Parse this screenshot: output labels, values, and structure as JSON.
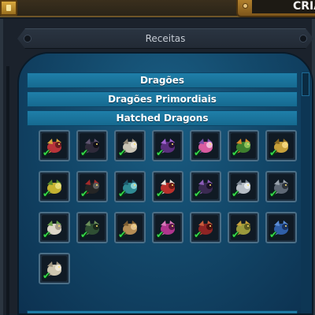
{
  "header": {
    "right_tab_label": "CRIA"
  },
  "panel": {
    "title": "Receitas"
  },
  "categories": [
    {
      "label": "Dragões"
    },
    {
      "label": "Dragões Primordiais"
    },
    {
      "label": "Hatched Dragons"
    }
  ],
  "recipes": [
    {
      "icon": "dragon-red-gold-icon",
      "colors": [
        "#b8343a",
        "#d7a63d",
        "#6a1c20"
      ],
      "crafted": true
    },
    {
      "icon": "dragon-dark-icon",
      "colors": [
        "#2e2a3a",
        "#5e5470",
        "#111018"
      ],
      "crafted": true
    },
    {
      "icon": "dragon-white-bone-icon",
      "colors": [
        "#c9c4b5",
        "#8c8373",
        "#e9e5da"
      ],
      "crafted": true
    },
    {
      "icon": "dragon-purple-shadow-icon",
      "colors": [
        "#5b2f7e",
        "#a061d0",
        "#241233"
      ],
      "crafted": true
    },
    {
      "icon": "dragon-pink-crystal-icon",
      "colors": [
        "#d95ba0",
        "#7a4da8",
        "#f1b6d9"
      ],
      "crafted": true
    },
    {
      "icon": "dragon-green-orange-icon",
      "colors": [
        "#3d7f2e",
        "#d88b2b",
        "#8cc25a"
      ],
      "crafted": true
    },
    {
      "icon": "dragon-gold-icon",
      "colors": [
        "#c8a13b",
        "#8c6a22",
        "#f1d27a"
      ],
      "crafted": true
    },
    {
      "icon": "dragon-yellow-green-icon",
      "colors": [
        "#c5b332",
        "#5b8d2c",
        "#e7de79"
      ],
      "crafted": true
    },
    {
      "icon": "dragon-black-red-icon",
      "colors": [
        "#252525",
        "#a32a2a",
        "#5f5f5f"
      ],
      "crafted": true
    },
    {
      "icon": "dragon-teal-icon",
      "colors": [
        "#2f8b94",
        "#1d5b6e",
        "#8ad3d6"
      ],
      "crafted": true
    },
    {
      "icon": "dragon-red-white-icon",
      "colors": [
        "#b9302b",
        "#e8e2d8",
        "#6b1a16"
      ],
      "crafted": true
    },
    {
      "icon": "dragon-violet-icon",
      "colors": [
        "#3a2a52",
        "#8c5db8",
        "#1a1226"
      ],
      "crafted": true
    },
    {
      "icon": "dragon-silver-icon",
      "colors": [
        "#b7bec6",
        "#7d8793",
        "#e6ebef"
      ],
      "crafted": true
    },
    {
      "icon": "dragon-steel-icon",
      "colors": [
        "#5e6875",
        "#9aa4ae",
        "#2d333b"
      ],
      "crafted": true
    },
    {
      "icon": "dragon-white-green-icon",
      "colors": [
        "#ddd7c9",
        "#6aa04a",
        "#a59c8a"
      ],
      "crafted": true
    },
    {
      "icon": "dragon-forest-icon",
      "colors": [
        "#2f4f34",
        "#6b8f5a",
        "#1a2a1d"
      ],
      "crafted": true
    },
    {
      "icon": "dragon-tan-icon",
      "colors": [
        "#b58d55",
        "#7c5c31",
        "#e2c28e"
      ],
      "crafted": true
    },
    {
      "icon": "dragon-magenta-icon",
      "colors": [
        "#b0358d",
        "#d779b9",
        "#5a1848"
      ],
      "crafted": true
    },
    {
      "icon": "dragon-crimson-icon",
      "colors": [
        "#8e2424",
        "#c95d3c",
        "#4a1010"
      ],
      "crafted": true
    },
    {
      "icon": "dragon-olive-gold-icon",
      "colors": [
        "#9a9a3c",
        "#c8a13b",
        "#5d5d22"
      ],
      "crafted": true
    },
    {
      "icon": "dragon-blue-icon",
      "colors": [
        "#2f5fa8",
        "#5a8cd6",
        "#1a3360"
      ],
      "crafted": true
    },
    {
      "icon": "dragon-pale-icon",
      "colors": [
        "#cfc7b1",
        "#9d9480",
        "#efe9da"
      ],
      "crafted": true
    }
  ],
  "check_mark": "✔"
}
